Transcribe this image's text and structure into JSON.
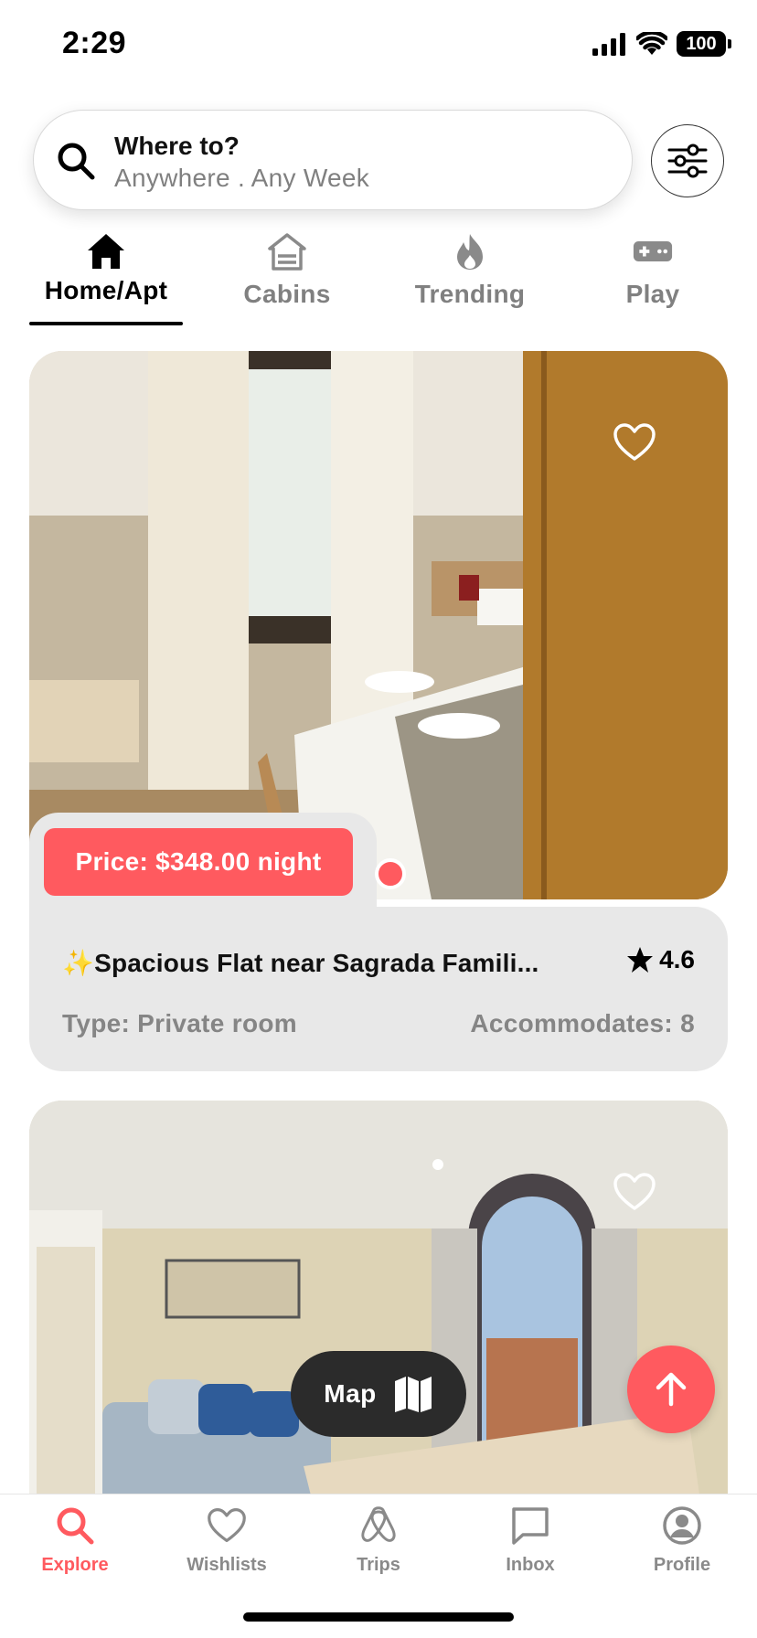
{
  "status_bar": {
    "time": "2:29",
    "battery": "100"
  },
  "search": {
    "title": "Where to?",
    "subtitle": "Anywhere . Any Week"
  },
  "tabs": [
    {
      "label": "Home/Apt",
      "icon": "house-icon",
      "active": true
    },
    {
      "label": "Cabins",
      "icon": "cabin-icon",
      "active": false
    },
    {
      "label": "Trending",
      "icon": "fire-icon",
      "active": false
    },
    {
      "label": "Play",
      "icon": "gamepad-icon",
      "active": false
    }
  ],
  "listings": [
    {
      "price": "Price: $348.00 night",
      "title": "✨Spacious Flat near Sagrada Famili...",
      "rating": "4.6",
      "type": "Type: Private room",
      "accommodates": "Accommodates: 8"
    }
  ],
  "map_button": {
    "label": "Map"
  },
  "bottom_nav": [
    {
      "label": "Explore",
      "icon": "search-icon",
      "active": true
    },
    {
      "label": "Wishlists",
      "icon": "heart-icon",
      "active": false
    },
    {
      "label": "Trips",
      "icon": "airbnb-logo-icon",
      "active": false
    },
    {
      "label": "Inbox",
      "icon": "chat-icon",
      "active": false
    },
    {
      "label": "Profile",
      "icon": "profile-icon",
      "active": false
    }
  ],
  "colors": {
    "accent": "#ff5a5f",
    "panel": "#e8e8e8",
    "muted": "#858585"
  }
}
